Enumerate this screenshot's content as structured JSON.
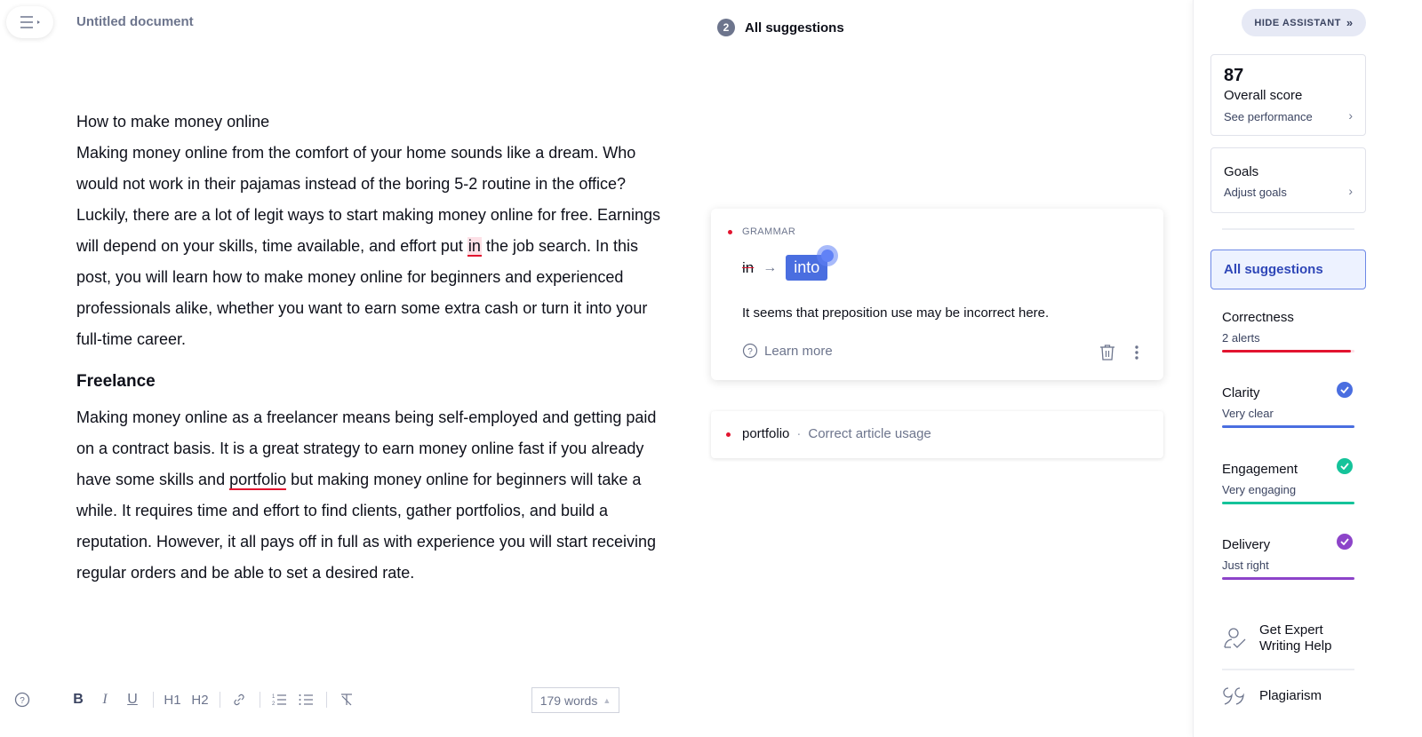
{
  "header": {
    "menu_icon": "hamburger-menu-icon",
    "doc_title": "Untitled document"
  },
  "document": {
    "title_line": "How to make money online",
    "intro_lines": {
      "part1": "Making money online from the comfort of your home sounds like a dream. Who would not work in their pajamas instead of the boring 5-2 routine in the office? Luckily, there are a lot of legit ways to start making money online for free. Earnings will depend on your skills, time available, and effort put ",
      "flagged": "in",
      "part2": " the job search. In this post, you will learn how to make money online for beginners and experienced professionals alike, whether you want to earn some extra cash or turn it into your full-time career."
    },
    "heading": "Freelance",
    "freelance": {
      "part1": "Making money online as a freelancer means being self-employed and getting paid on a contract basis. It is a great strategy to earn money online fast if you already have some skills and ",
      "flagged": "portfolio",
      "part2": " but making money online for beginners will take a while. It requires time and effort to find clients, gather portfolios, and build a reputation. However, it all pays off in full as with experience you will start receiving regular orders and be able to set a desired rate."
    }
  },
  "toolbar": {
    "help_icon": "help-circle-icon",
    "bold": "B",
    "italic": "I",
    "underline": "U",
    "h1": "H1",
    "h2": "H2",
    "link_icon": "link-icon",
    "ordered_list_icon": "ordered-list-icon",
    "bullet_list_icon": "bullet-list-icon",
    "clear_format_icon": "clear-format-icon",
    "word_count": "179 words"
  },
  "suggestions": {
    "count": "2",
    "title": "All suggestions",
    "active_card": {
      "category": "GRAMMAR",
      "original": "in",
      "replacement": "into",
      "message": "It seems that preposition use may be incorrect here.",
      "learn_more": "Learn more"
    },
    "collapsed_card": {
      "word": "portfolio",
      "separator": "·",
      "description": "Correct article usage"
    }
  },
  "sidebar": {
    "hide_label": "HIDE ASSISTANT",
    "score": {
      "value": "87",
      "label": "Overall score",
      "sub": "See performance"
    },
    "goals": {
      "label": "Goals",
      "sub": "Adjust goals"
    },
    "all_suggestions": "All suggestions",
    "metrics": [
      {
        "name": "Correctness",
        "status": "2 alerts",
        "color": "#e2142f",
        "progress": 0.97,
        "checked": false
      },
      {
        "name": "Clarity",
        "status": "Very clear",
        "color": "#4a6ee0",
        "progress": 1.0,
        "checked": true
      },
      {
        "name": "Engagement",
        "status": "Very engaging",
        "color": "#15c39a",
        "progress": 1.0,
        "checked": true
      },
      {
        "name": "Delivery",
        "status": "Just right",
        "color": "#8d44c9",
        "progress": 1.0,
        "checked": true
      }
    ],
    "expert_help": "Get Expert Writing Help",
    "expert_line1": "Get Expert",
    "expert_line2": "Writing Help",
    "plagiarism": "Plagiarism"
  },
  "colors": {
    "accent": "#4a6ee0",
    "error": "#e2142f",
    "muted": "#6d758d"
  }
}
